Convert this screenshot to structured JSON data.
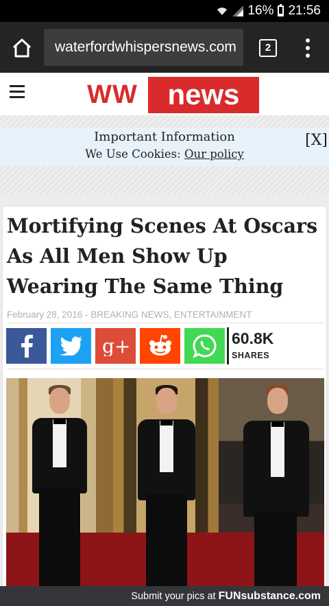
{
  "status_bar": {
    "battery_percent": "16%",
    "battery_level": 0.16,
    "time": "21:56"
  },
  "browser": {
    "url": "waterfordwhispersnews.com",
    "tab_count": "2"
  },
  "site": {
    "logo_left": "WW",
    "logo_right": "news"
  },
  "cookie_banner": {
    "title": "Important Information",
    "text": "We Use Cookies:",
    "link": "Our policy",
    "close": "[X]"
  },
  "article": {
    "headline": "Mortifying Scenes At Oscars As All Men Show Up Wearing The Same Thing",
    "date": "February 28, 2016",
    "separator": " - ",
    "categories": "BREAKING NEWS, ENTERTAINMENT",
    "shares_count": "60.8K",
    "shares_label": "SHARES",
    "share_buttons": [
      {
        "name": "facebook",
        "color": "#3b5998"
      },
      {
        "name": "twitter",
        "color": "#1da1f2"
      },
      {
        "name": "google-plus",
        "color": "#dd4b39"
      },
      {
        "name": "reddit",
        "color": "#ff4500"
      },
      {
        "name": "whatsapp",
        "color": "#43d854"
      }
    ]
  },
  "footer": {
    "text": "Submit your pics at",
    "brand": "FUNsubstance.com"
  }
}
